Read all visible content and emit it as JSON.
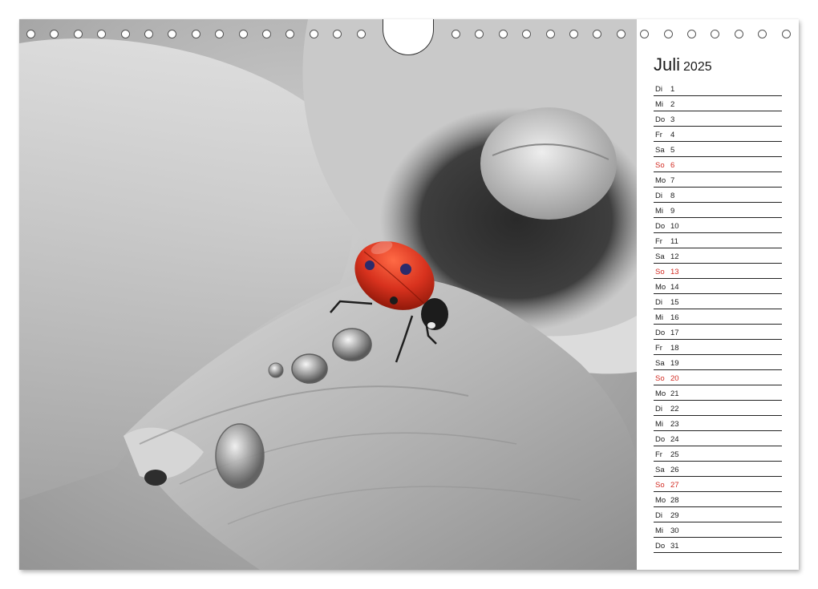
{
  "calendar": {
    "month": "Juli",
    "year": "2025",
    "sunday_color": "#d22b22",
    "days": [
      {
        "wd": "Di",
        "d": "1"
      },
      {
        "wd": "Mi",
        "d": "2"
      },
      {
        "wd": "Do",
        "d": "3"
      },
      {
        "wd": "Fr",
        "d": "4"
      },
      {
        "wd": "Sa",
        "d": "5"
      },
      {
        "wd": "So",
        "d": "6",
        "sunday": true
      },
      {
        "wd": "Mo",
        "d": "7"
      },
      {
        "wd": "Di",
        "d": "8"
      },
      {
        "wd": "Mi",
        "d": "9"
      },
      {
        "wd": "Do",
        "d": "10"
      },
      {
        "wd": "Fr",
        "d": "11"
      },
      {
        "wd": "Sa",
        "d": "12"
      },
      {
        "wd": "So",
        "d": "13",
        "sunday": true
      },
      {
        "wd": "Mo",
        "d": "14"
      },
      {
        "wd": "Di",
        "d": "15"
      },
      {
        "wd": "Mi",
        "d": "16"
      },
      {
        "wd": "Do",
        "d": "17"
      },
      {
        "wd": "Fr",
        "d": "18"
      },
      {
        "wd": "Sa",
        "d": "19"
      },
      {
        "wd": "So",
        "d": "20",
        "sunday": true
      },
      {
        "wd": "Mo",
        "d": "21"
      },
      {
        "wd": "Di",
        "d": "22"
      },
      {
        "wd": "Mi",
        "d": "23"
      },
      {
        "wd": "Do",
        "d": "24"
      },
      {
        "wd": "Fr",
        "d": "25"
      },
      {
        "wd": "Sa",
        "d": "26"
      },
      {
        "wd": "So",
        "d": "27",
        "sunday": true
      },
      {
        "wd": "Mo",
        "d": "28"
      },
      {
        "wd": "Di",
        "d": "29"
      },
      {
        "wd": "Mi",
        "d": "30"
      },
      {
        "wd": "Do",
        "d": "31"
      }
    ]
  },
  "photo": {
    "subject": "ladybug-on-poppy-petal",
    "ladybug_color": "#d8321e"
  }
}
